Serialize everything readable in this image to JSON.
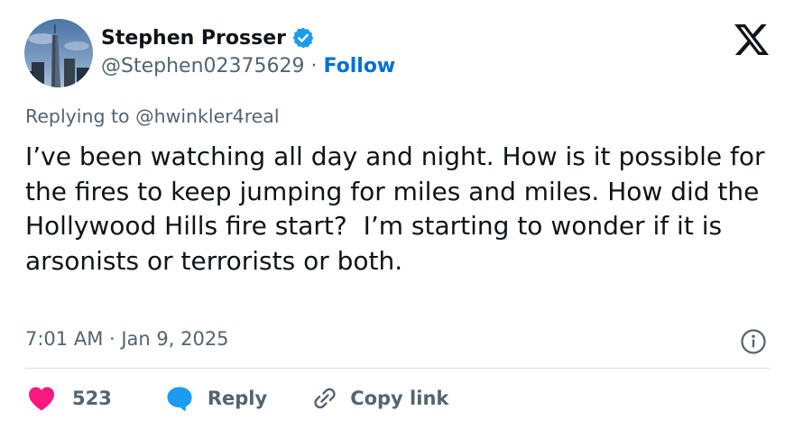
{
  "author": {
    "name": "Stephen Prosser",
    "handle": "@Stephen02375629",
    "separator": " · ",
    "follow_label": "Follow",
    "verified": true
  },
  "brand": {
    "logo": "x-logo-icon"
  },
  "tweet": {
    "reply_prefix": "Replying to ",
    "reply_to": "@hwinkler4real",
    "text": "I’ve been watching all day and night. How is it possible for the fires to keep jumping for miles and miles. How did the Hollywood Hills fire start?  I’m starting to wonder if it is arsonists or terrorists or both.",
    "timestamp": "7:01 AM · Jan 9, 2025"
  },
  "actions": {
    "like_count": "523",
    "reply_label": "Reply",
    "copy_link_label": "Copy link"
  },
  "colors": {
    "text": "#0f1419",
    "secondary": "#536471",
    "follow": "#006fd6",
    "verified": "#1d9bf0",
    "like": "#f91880",
    "reply": "#1d9bf0",
    "divider": "#d4dde3"
  },
  "icons": [
    "verified-badge-icon",
    "x-logo-icon",
    "info-icon",
    "heart-icon",
    "speech-bubble-icon",
    "link-icon"
  ]
}
